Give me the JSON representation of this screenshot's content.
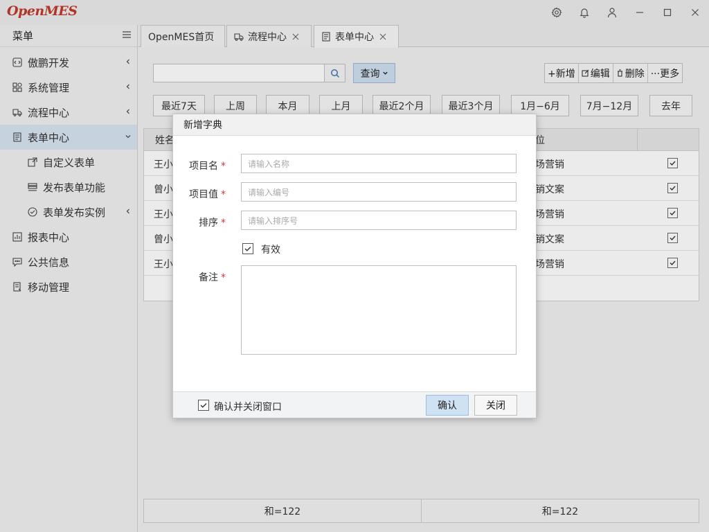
{
  "app": {
    "logo_text": "OpenMES"
  },
  "window_controls": [
    "gear-icon",
    "bell-icon",
    "user-icon",
    "minimize-icon",
    "maximize-icon",
    "close-icon"
  ],
  "sidebar": {
    "title": "菜单",
    "items": [
      {
        "label": "傲鹏开发",
        "icon": "code-icon"
      },
      {
        "label": "系统管理",
        "icon": "grid-icon"
      },
      {
        "label": "流程中心",
        "icon": "truck-icon"
      },
      {
        "label": "表单中心",
        "icon": "form-icon",
        "expanded": true
      },
      {
        "label": "报表中心",
        "icon": "chart-icon"
      },
      {
        "label": "公共信息",
        "icon": "message-icon"
      },
      {
        "label": "移动管理",
        "icon": "mobile-icon"
      }
    ],
    "subitems": [
      {
        "label": "自定义表单",
        "icon": "edit-form-icon"
      },
      {
        "label": "发布表单功能",
        "icon": "stack-icon"
      },
      {
        "label": "表单发布实例",
        "icon": "check-circle-icon"
      }
    ]
  },
  "tabs": [
    {
      "label": "OpenMES首页"
    },
    {
      "label": "流程中心"
    },
    {
      "label": "表单中心",
      "active": true
    }
  ],
  "toolbar": {
    "search_placeholder": "",
    "query_label": "查询",
    "actions": [
      "+新增",
      "编辑",
      "删除",
      "···更多"
    ]
  },
  "date_filters": [
    "最近7天",
    "上周",
    "本月",
    "上月",
    "最近2个月",
    "最近3个月",
    "1月−6月",
    "7月−12月",
    "去年"
  ],
  "grid": {
    "header_col1": "姓名",
    "header_col2": "位",
    "rows": [
      {
        "name": "王小",
        "dept": "场营销"
      },
      {
        "name": "曾小",
        "dept": "销文案"
      },
      {
        "name": "王小",
        "dept": "场营销"
      },
      {
        "name": "曾小",
        "dept": "销文案"
      },
      {
        "name": "王小",
        "dept": "场营销"
      }
    ]
  },
  "footer": {
    "sum_left": "和=122",
    "sum_right": "和=122"
  },
  "dialog": {
    "title": "新增字典",
    "fields": [
      {
        "label": "项目名",
        "placeholder": "请输入名称"
      },
      {
        "label": "项目值",
        "placeholder": "请输入编号"
      },
      {
        "label": "排序",
        "placeholder": "请输入排序号"
      }
    ],
    "valid_label": "有效",
    "remark_label": "备注",
    "required_mark": "*",
    "confirm_close_label": "确认并关闭窗口",
    "ok_label": "确认",
    "close_label": "关闭"
  }
}
